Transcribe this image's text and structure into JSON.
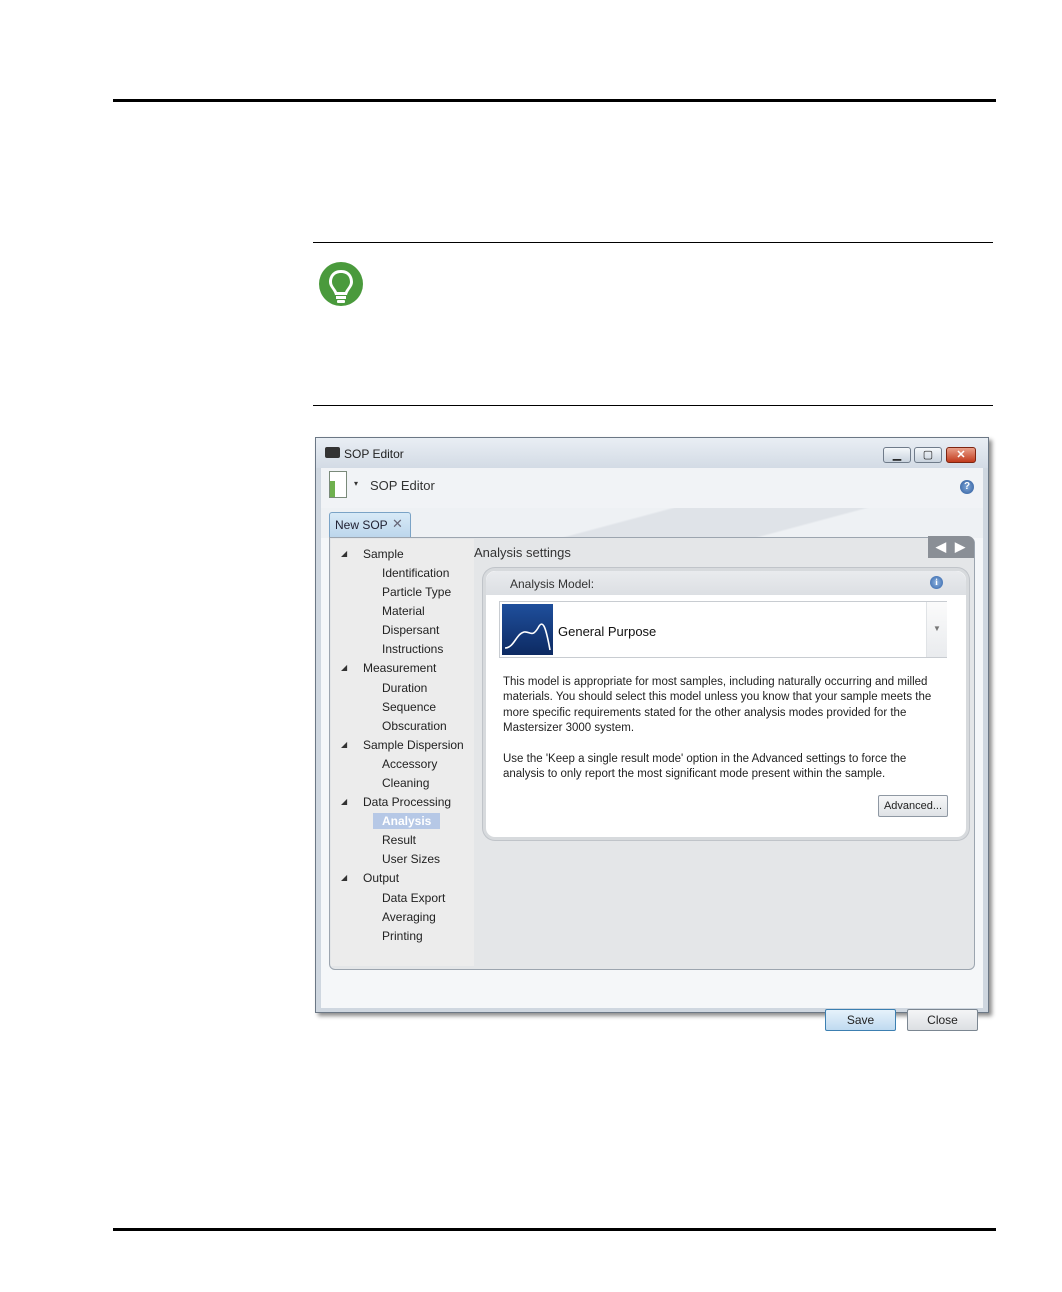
{
  "window": {
    "title": "SOP Editor",
    "controls": {
      "minimize": "▁",
      "maximize": "▢",
      "close": "✕"
    }
  },
  "toolbar": {
    "title": "SOP Editor",
    "dropdown_arrow": "▾",
    "help": "?"
  },
  "tab": {
    "label": "New SOP",
    "close": "✕"
  },
  "nav": {
    "sections": [
      {
        "label": "Sample",
        "items": [
          "Identification",
          "Particle Type",
          "Material",
          "Dispersant",
          "Instructions"
        ]
      },
      {
        "label": "Measurement",
        "items": [
          "Duration",
          "Sequence",
          "Obscuration"
        ]
      },
      {
        "label": "Sample Dispersion",
        "items": [
          "Accessory",
          "Cleaning"
        ]
      },
      {
        "label": "Data Processing",
        "items": [
          "Analysis",
          "Result",
          "User Sizes"
        ]
      },
      {
        "label": "Output",
        "items": [
          "Data Export",
          "Averaging",
          "Printing"
        ]
      }
    ],
    "selected": "Analysis",
    "expander": "◢"
  },
  "settings": {
    "title": "Analysis settings",
    "pager": {
      "prev": "◀",
      "next": "▶"
    },
    "panel": {
      "header": "Analysis Model:",
      "info": "i",
      "model": "General Purpose",
      "model_dropdown": "▼",
      "description_1": "This model is appropriate for most samples, including naturally occurring and milled materials. You should select this model unless you know that your sample meets the more specific requirements stated for the other analysis modes provided for the Mastersizer 3000 system.",
      "description_2": "Use the 'Keep a single result mode' option in the Advanced settings to force the analysis to only report the most significant mode present within the sample.",
      "advanced_button": "Advanced..."
    }
  },
  "footer": {
    "save": "Save",
    "close": "Close"
  },
  "colors": {
    "hint_icon": "#4a9a3c",
    "selection": "#b6c8e6",
    "model_thumb": "#1f4f9c"
  }
}
